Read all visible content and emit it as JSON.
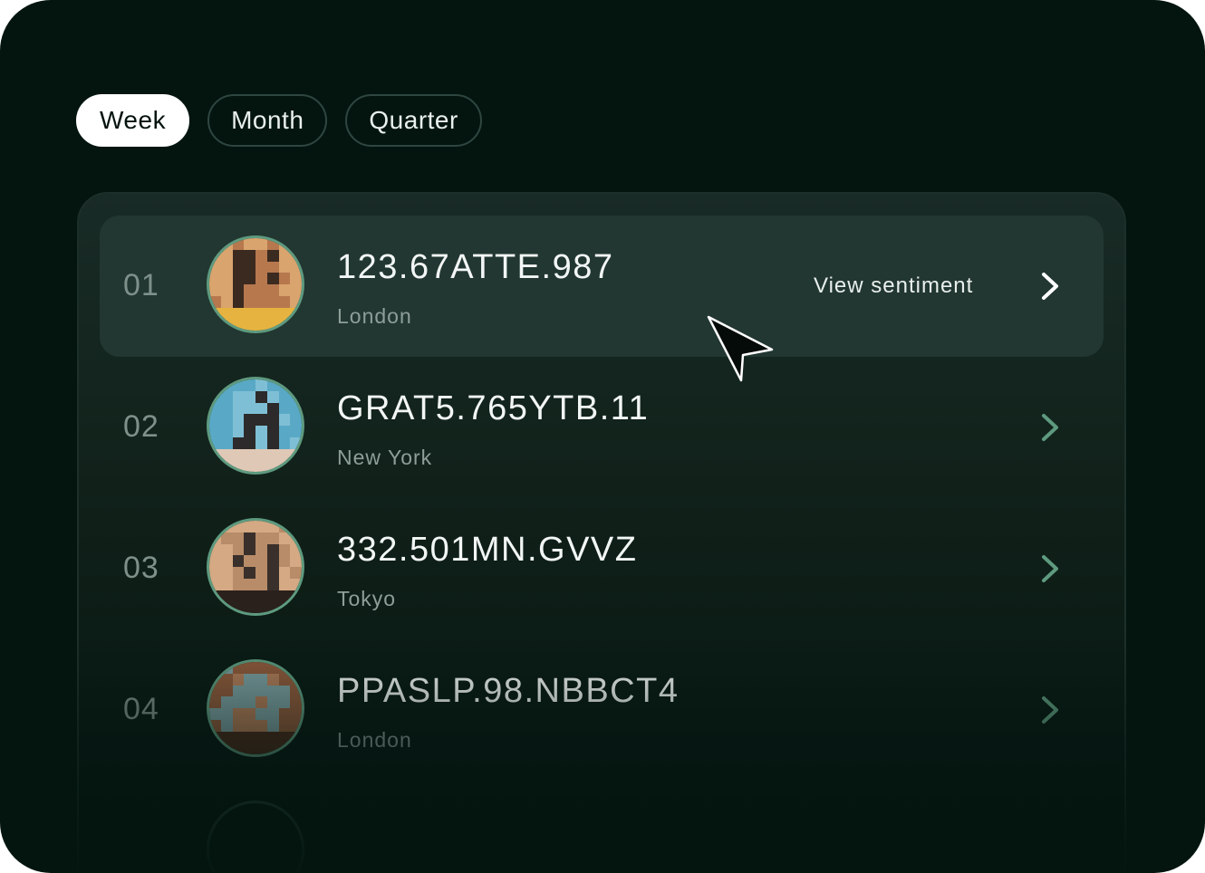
{
  "filters": {
    "tabs": [
      {
        "label": "Week",
        "active": true
      },
      {
        "label": "Month",
        "active": false
      },
      {
        "label": "Quarter",
        "active": false
      }
    ]
  },
  "list": {
    "hover_action_label": "View sentiment",
    "rows": [
      {
        "rank": "01",
        "code": "123.67ATTE.987",
        "city": "London",
        "avatar_palette": [
          "#d9a46e",
          "#e7b340",
          "#3b2a20",
          "#b7784e"
        ]
      },
      {
        "rank": "02",
        "code": "GRAT5.765YTB.11",
        "city": "New York",
        "avatar_palette": [
          "#59a9c6",
          "#e0c8b6",
          "#2c2a2a",
          "#7fbfd6"
        ]
      },
      {
        "rank": "03",
        "code": "332.501MN.GVVZ",
        "city": "Tokyo",
        "avatar_palette": [
          "#d4a983",
          "#2a211c",
          "#3a302b",
          "#b88c68"
        ]
      },
      {
        "rank": "04",
        "code": "PPASLP.98.NBBCT4",
        "city": "London",
        "avatar_palette": [
          "#8e5a3c",
          "#4b2b1c",
          "#b07b58",
          "#7b9ea0"
        ]
      }
    ]
  },
  "colors": {
    "background": "#041510",
    "panel": "#192b26",
    "accent_chevron": "#5e9a7f"
  }
}
